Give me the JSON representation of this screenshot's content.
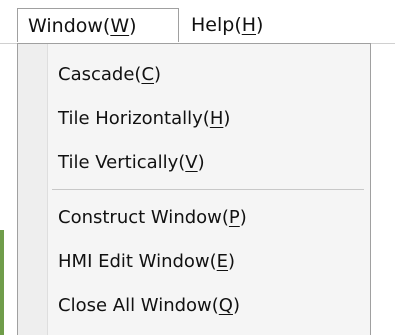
{
  "menubar": {
    "window": {
      "label": "Window(",
      "accel": "W",
      "suffix": ")"
    },
    "help": {
      "label": "Help(",
      "accel": "H",
      "suffix": ")"
    }
  },
  "window_menu": {
    "items": [
      {
        "label": "Cascade(",
        "accel": "C",
        "suffix": ")"
      },
      {
        "label": "Tile Horizontally(",
        "accel": "H",
        "suffix": ")"
      },
      {
        "label": "Tile Vertically(",
        "accel": "V",
        "suffix": ")"
      },
      {
        "label": "Construct Window(",
        "accel": "P",
        "suffix": ")"
      },
      {
        "label": "HMI Edit Window(",
        "accel": "E",
        "suffix": ")"
      },
      {
        "label": "Close All Window(",
        "accel": "Q",
        "suffix": ")"
      }
    ]
  },
  "colors": {
    "menu_background": "#f5f5f5",
    "border": "#a0a0a0",
    "separator": "#c8c8c8",
    "background_edge": "#6f9d4a"
  }
}
